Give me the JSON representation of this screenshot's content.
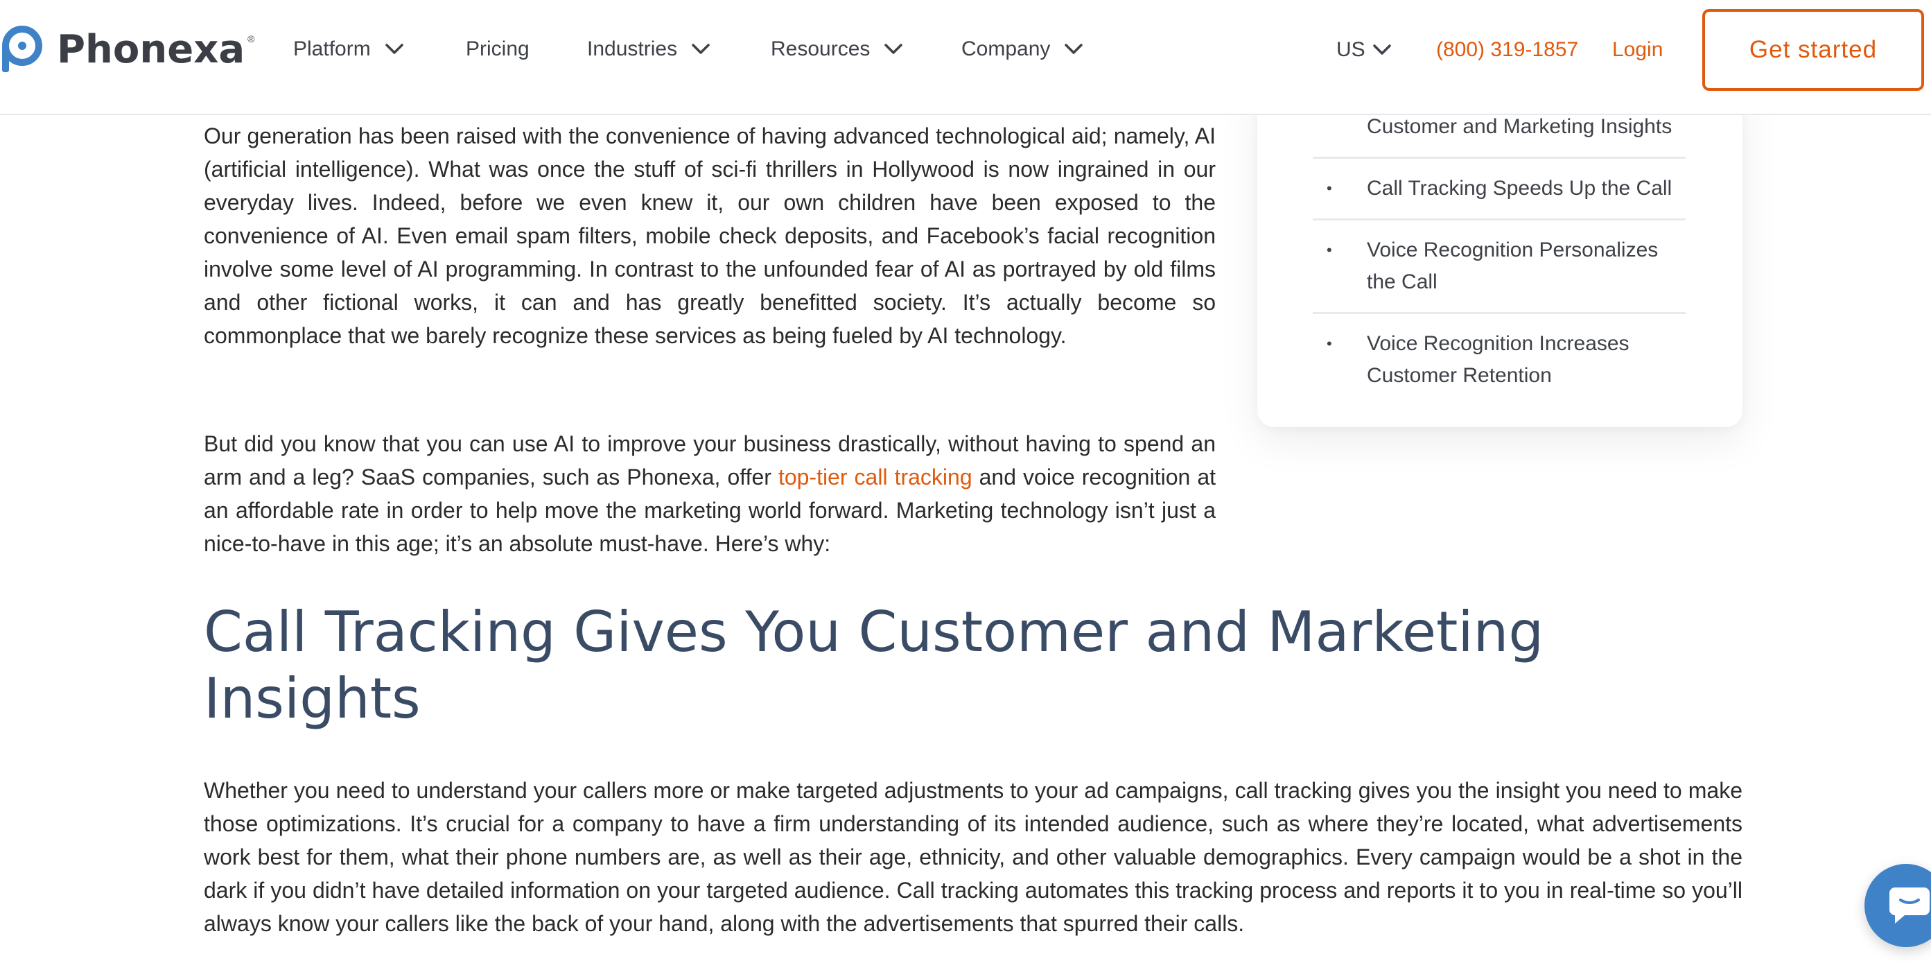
{
  "brand": {
    "name": "Phonexa",
    "registered": "®"
  },
  "nav": {
    "platform": "Platform",
    "pricing": "Pricing",
    "industries": "Industries",
    "resources": "Resources",
    "company": "Company",
    "region": "US",
    "phone": "(800) 319-1857",
    "login": "Login",
    "cta": "Get started"
  },
  "colors": {
    "accent": "#e05a0c",
    "heading": "#3a4b66",
    "logo_blue": "#3f82c7",
    "text": "#2b2b2b"
  },
  "toc": {
    "items": [
      "Customer and Marketing Insights",
      "Call Tracking Speeds Up the Call",
      "Voice Recognition Personalizes the Call",
      "Voice Recognition Increases Customer Retention"
    ],
    "bullet": "•"
  },
  "article": {
    "p1": "Our generation has been raised with the convenience of having advanced technological aid; namely, AI (artificial intelligence). What was once the stuff of sci-fi thrillers in Hollywood is now ingrained in our everyday lives. Indeed, before we even knew it, our own children have been exposed to the convenience of AI. Even email spam filters, mobile check deposits, and Facebook’s facial recognition involve some level of AI programming. In contrast to the unfounded fear of AI as portrayed by old films and other fictional works, it can and has greatly benefitted society. It’s actually become so commonplace that we barely recognize these services as being fueled by AI technology.",
    "p2_before": "But did you know that you can use AI to improve your business drastically, without having to spend an arm and a leg? SaaS companies, such as Phonexa, offer ",
    "p2_link": "top-tier call tracking",
    "p2_after": " and voice recognition at an affordable rate in order to help move the marketing world forward. Marketing technology isn’t just a nice-to-have in this age; it’s an absolute must-have. Here’s why:",
    "heading": "Call Tracking Gives You Customer and Marketing Insights",
    "p3": "Whether you need to understand your callers more or make targeted adjustments to your ad campaigns, call tracking gives you the insight you need to make those optimizations. It’s crucial for a company to have a firm understanding of its intended audience, such as where they’re located, what advertisements work best for them, what their phone numbers are, as well as their age, ethnicity, and other valuable demographics. Every campaign would be a shot in the dark if you didn’t have detailed information on your targeted audience. Call tracking automates this tracking process and reports it to you in real-time so you’ll always know your callers like the back of your hand, along with the advertisements that spurred their calls."
  },
  "icons": {
    "logo": "phonexa-logo-icon",
    "chevron": "chevron-down-icon",
    "chat": "chat-bubble-icon"
  }
}
